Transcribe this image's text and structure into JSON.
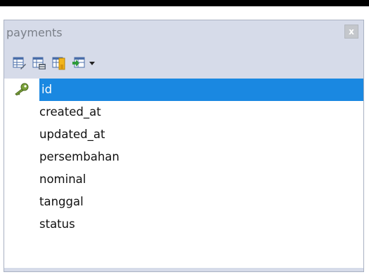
{
  "panel": {
    "title": "payments",
    "close_label": "x"
  },
  "toolbar": {
    "buttons": [
      {
        "icon": "table-edit-icon"
      },
      {
        "icon": "table-properties-icon"
      },
      {
        "icon": "table-key-icon"
      },
      {
        "icon": "table-insert-icon"
      }
    ],
    "dropdown_icon": "chevron-down-icon"
  },
  "fields": [
    {
      "name": "id",
      "primary_key": true,
      "selected": true
    },
    {
      "name": "created_at"
    },
    {
      "name": "updated_at"
    },
    {
      "name": "persembahan"
    },
    {
      "name": "nominal"
    },
    {
      "name": "tanggal"
    },
    {
      "name": "status"
    }
  ],
  "colors": {
    "selection": "#1a88e1",
    "panel_bg": "#d6dbe9"
  }
}
